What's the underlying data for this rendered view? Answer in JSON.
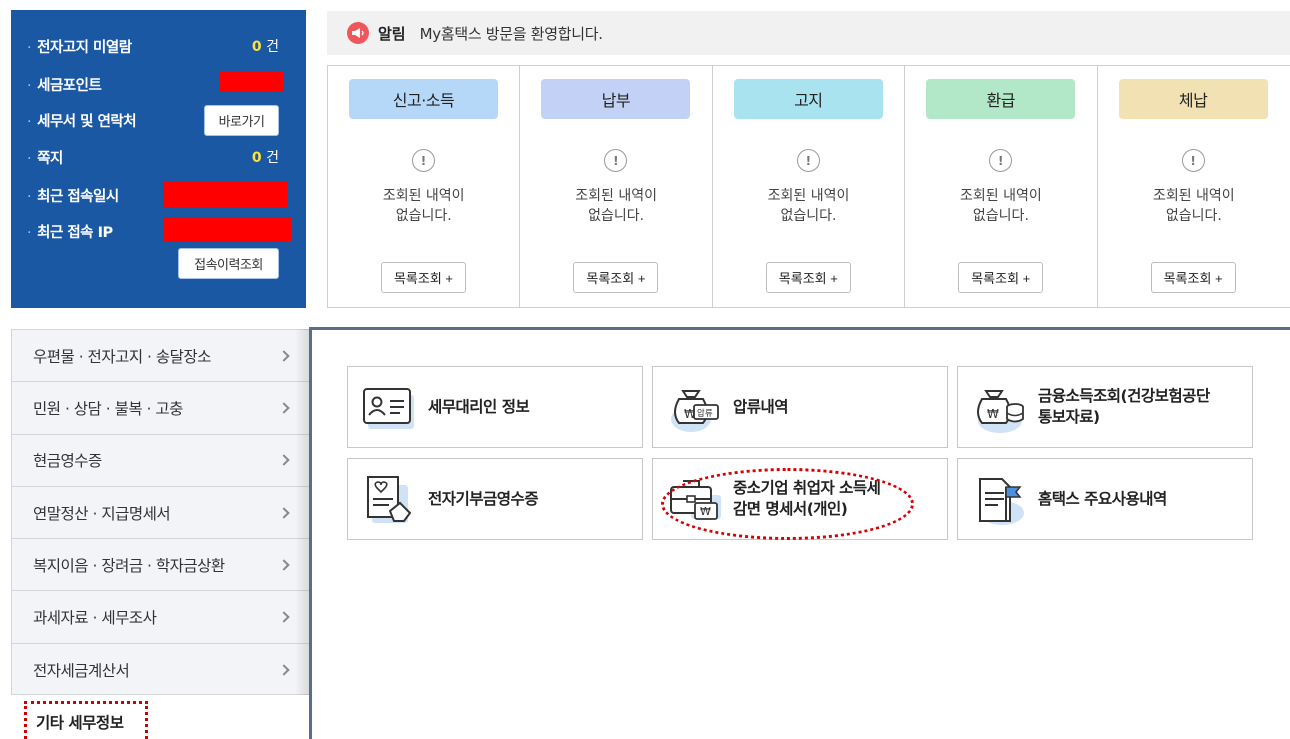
{
  "info_panel": {
    "unread_notices_label": "전자고지 미열람",
    "unread_notices_count": "0",
    "unit": "건",
    "tax_point_label": "세금포인트",
    "office_label": "세무서 및 연락처",
    "shortcut_button": "바로가기",
    "message_label": "쪽지",
    "message_count": "0",
    "last_access_label": "최근 접속일시",
    "last_ip_label": "최근 접속 IP",
    "access_history_button": "접속이력조회"
  },
  "notice": {
    "title": "알림",
    "text": "My홈택스 방문을 환영합니다."
  },
  "categories": [
    {
      "label": "신고·소득",
      "color": "#b5d8f8"
    },
    {
      "label": "납부",
      "color": "#c2d1f5"
    },
    {
      "label": "고지",
      "color": "#a9e3ef"
    },
    {
      "label": "환급",
      "color": "#b2e7c8"
    },
    {
      "label": "체납",
      "color": "#f1e1b3"
    }
  ],
  "category_empty_line1": "조회된 내역이",
  "category_empty_line2": "없습니다.",
  "category_list_button": "목록조회 +",
  "side_menu": [
    "우편물 · 전자고지 · 송달장소",
    "민원 · 상담 · 불복 · 고충",
    "현금영수증",
    "연말정산 · 지급명세서",
    "복지이음 · 장려금 · 학자금상환",
    "과세자료 · 세무조사",
    "전자세금계산서"
  ],
  "selected_menu": "기타 세무정보",
  "tiles": [
    {
      "line1": "세무대리인 정보",
      "line2": "",
      "icon": "id-card-icon"
    },
    {
      "line1": "압류내역",
      "line2": "",
      "icon": "seizure-bag-icon"
    },
    {
      "line1": "금융소득조회(건강보험공단",
      "line2": "통보자료)",
      "icon": "money-bag-icon"
    },
    {
      "line1": "전자기부금영수증",
      "line2": "",
      "icon": "donation-receipt-icon"
    },
    {
      "line1": "중소기업 취업자 소득세",
      "line2": "감면 명세서(개인)",
      "icon": "briefcase-won-icon"
    },
    {
      "line1": "홈택스 주요사용내역",
      "line2": "",
      "icon": "document-flag-icon"
    }
  ],
  "colors": {
    "panel_blue": "#1a58a4",
    "highlight_red": "#d80000",
    "count_yellow": "#ffe13c"
  }
}
